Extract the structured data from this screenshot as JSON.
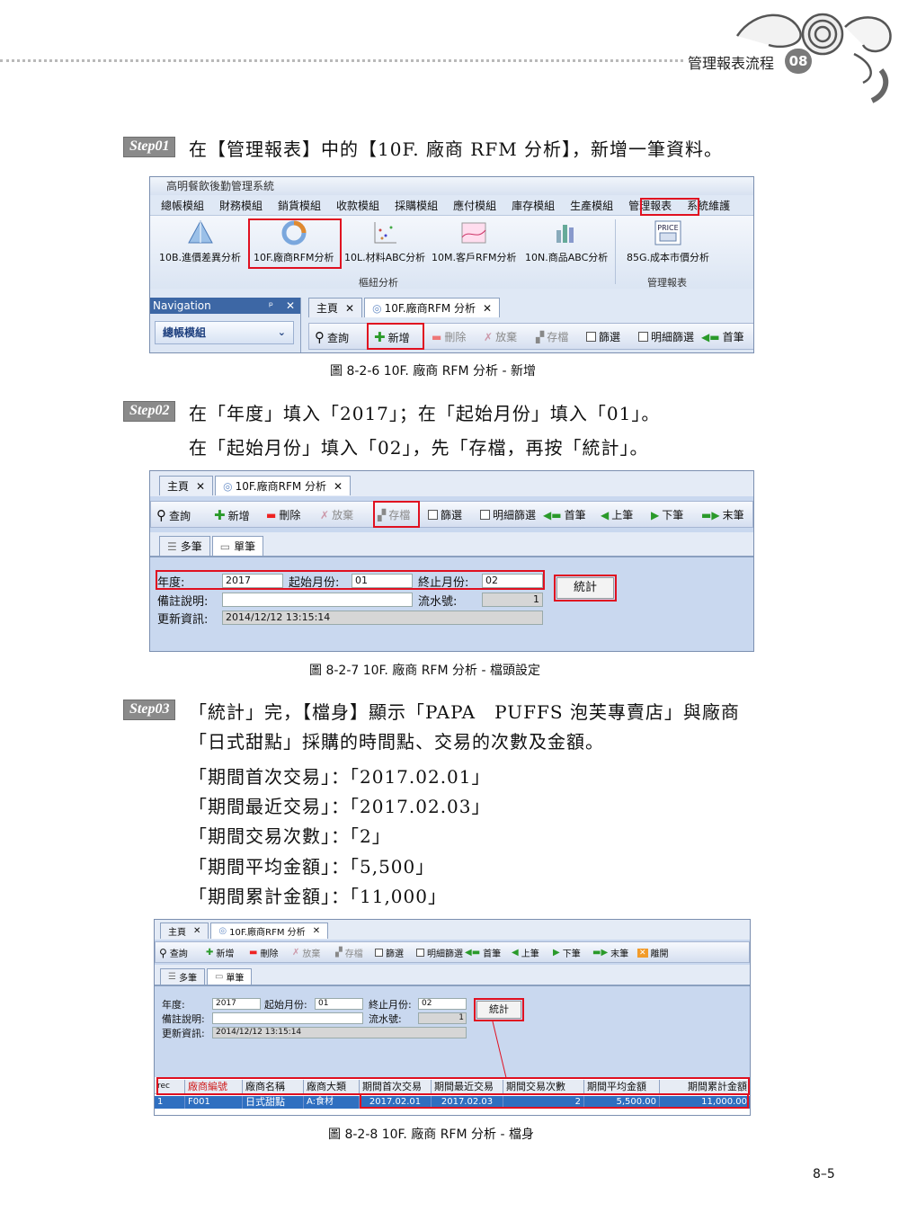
{
  "header": {
    "chapter_title": "管理報表流程",
    "chapter_number": "08"
  },
  "step01": {
    "badge": "Step01",
    "text": "在【管理報表】中的【10F. 廠商 RFM 分析】，新增一筆資料。"
  },
  "step02": {
    "badge": "Step02",
    "line1": "在「年度」填入「2017」；在「起始月份」填入「01」。",
    "line2": "在「起始月份」填入「02」，先「存檔，再按「統計」。"
  },
  "step03": {
    "badge": "Step03",
    "line1": "「統計」完，【檔身】顯示「PAPA　PUFFS 泡芙專賣店」與廠商",
    "line2": "「日式甜點」採購的時間點、交易的次數及金額。",
    "items": [
      "「期間首次交易」：「2017.02.01」",
      "「期間最近交易」：「2017.02.03」",
      "「期間交易次數」：「2」",
      "「期間平均金額」：「5,500」",
      "「期間累計金額」：「11,000」"
    ]
  },
  "figures": {
    "fig1_caption": "圖 8-2-6  10F. 廠商 RFM 分析 - 新增",
    "fig2_caption": "圖 8-2-7  10F. 廠商 RFM 分析 - 檔頭設定",
    "fig3_caption": "圖 8-2-8  10F. 廠商 RFM 分析 - 檔身"
  },
  "app": {
    "window_title": "高明餐飲後勤管理系統",
    "menu": [
      "總帳模組",
      "財務模組",
      "銷貨模組",
      "收款模組",
      "採購模組",
      "應付模組",
      "庫存模組",
      "生產模組",
      "管理報表",
      "系統維護"
    ],
    "ribbon_buttons": [
      "10B.進價差異分析",
      "10F.廠商RFM分析",
      "10L.材料ABC分析",
      "10M.客戶RFM分析",
      "10N.商品ABC分析",
      "85G.成本市價分析"
    ],
    "ribbon_groups": [
      "樞紐分析",
      "管理報表"
    ],
    "price_icon_text": "PRICE",
    "navigation_title": "Navigation",
    "navigation_pin": "ᵖ",
    "navigation_group": "總帳模組",
    "tabs": [
      "主頁",
      "10F.廠商RFM 分析"
    ],
    "toolbar": {
      "query": "查詢",
      "add": "新增",
      "delete": "刪除",
      "discard": "放棄",
      "save": "存檔",
      "filter": "篩選",
      "detail_filter": "明細篩選",
      "first": "首筆",
      "prev": "上筆",
      "next": "下筆",
      "last": "末筆",
      "close": "離開"
    },
    "subtabs": [
      "多筆",
      "單筆"
    ],
    "form": {
      "year_label": "年度:",
      "year_value": "2017",
      "start_month_label": "起始月份:",
      "start_month_value": "01",
      "end_month_label": "終止月份:",
      "end_month_value": "02",
      "note_label": "備註說明:",
      "note_value": "",
      "serial_label": "流水號:",
      "serial_value": "1",
      "updated_label": "更新資訊:",
      "updated_value": "2014/12/12 13:15:14",
      "stat_button": "統計"
    },
    "grid": {
      "columns": [
        "rec",
        "廠商編號",
        "廠商名稱",
        "廠商大類",
        "期間首次交易",
        "期間最近交易",
        "期間交易次數",
        "期間平均金額",
        "期間累計金額"
      ],
      "rows": [
        [
          "1",
          "F001",
          "日式甜點",
          "A:食材",
          "2017.02.01",
          "2017.02.03",
          "2",
          "5,500.00",
          "11,000.00"
        ]
      ]
    }
  },
  "page_number": "8–5",
  "colors": {
    "highlight_red": "#e01020",
    "ribbon_blue": "#dfe8f5",
    "selected_row": "#2f6fc0"
  }
}
